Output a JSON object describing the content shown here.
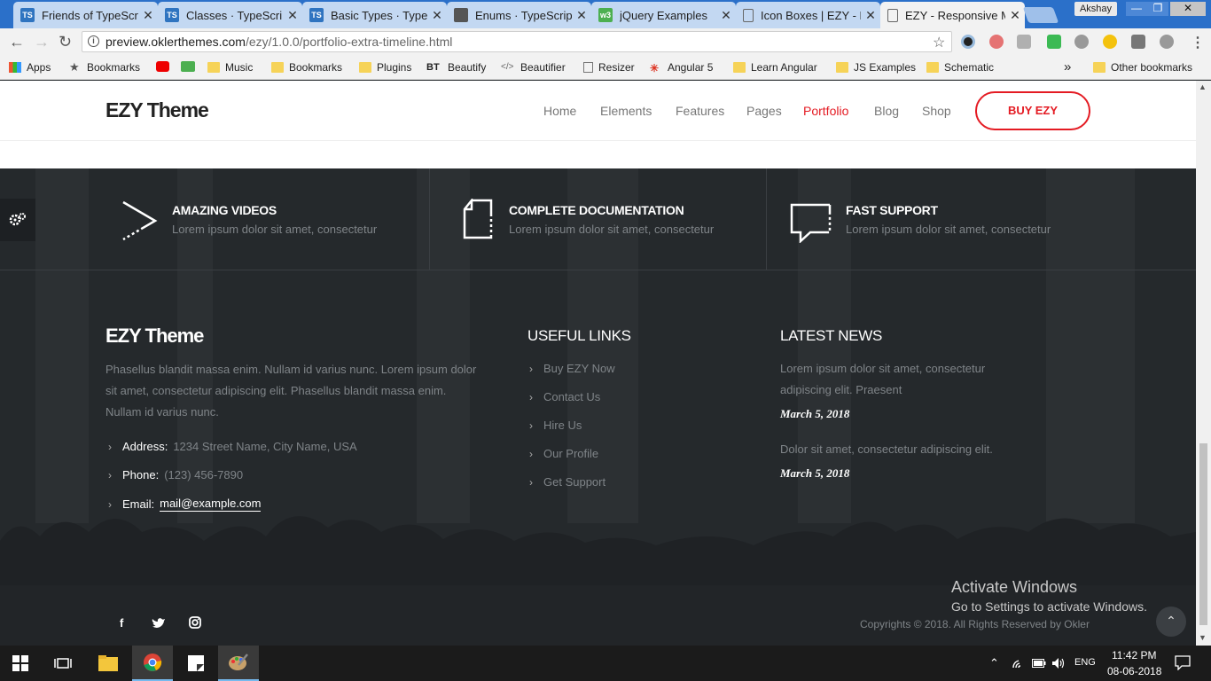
{
  "browser": {
    "tabs": [
      {
        "title": "Friends of TypeScrip",
        "icon": "TS"
      },
      {
        "title": "Classes · TypeScript",
        "icon": "TS"
      },
      {
        "title": "Basic Types · TypeSc",
        "icon": "TS"
      },
      {
        "title": "Enums · TypeScript",
        "icon": "book"
      },
      {
        "title": "jQuery Examples",
        "icon": "w3"
      },
      {
        "title": "Icon Boxes | EZY - R",
        "icon": "page"
      },
      {
        "title": "EZY - Responsive M",
        "icon": "page"
      }
    ],
    "profile": "Akshay",
    "url_host": "preview.oklerthemes.com",
    "url_path": "/ezy/1.0.0/portfolio-extra-timeline.html",
    "bookmarks": [
      "Apps",
      "Bookmarks",
      "Music",
      "Bookmarks",
      "Plugins",
      "Beautify",
      "Beautifier",
      "Resizer",
      "Angular 5",
      "Learn Angular",
      "JS Examples",
      "Schematic"
    ],
    "bookmarks_more": "»",
    "other_bookmarks": "Other bookmarks"
  },
  "site": {
    "logo": "EZY Theme",
    "nav": [
      "Home",
      "Elements",
      "Features",
      "Pages",
      "Portfolio",
      "Blog",
      "Shop"
    ],
    "nav_active": "Portfolio",
    "buy": "BUY EZY",
    "accent": "#e41b23"
  },
  "features": [
    {
      "title": "AMAZING VIDEOS",
      "desc": "Lorem ipsum dolor sit amet, consectetur",
      "icon": "play-icon"
    },
    {
      "title": "COMPLETE DOCUMENTATION",
      "desc": "Lorem ipsum dolor sit amet, consectetur",
      "icon": "document-icon"
    },
    {
      "title": "FAST SUPPORT",
      "desc": "Lorem ipsum dolor sit amet, consectetur",
      "icon": "chat-icon"
    }
  ],
  "footer": {
    "about": {
      "logo": "EZY Theme",
      "text1": "Phasellus blandit massa enim. Nullam id varius nunc. Lorem ipsum dolor",
      "text2": "sit amet, consectetur adipiscing elit. Phasellus blandit massa enim.",
      "text3": "Nullam id varius nunc.",
      "address_label": "Address:",
      "address": "1234 Street Name, City Name, USA",
      "phone_label": "Phone:",
      "phone": "(123) 456-7890",
      "email_label": "Email:",
      "email": "mail@example.com"
    },
    "links": {
      "title": "USEFUL LINKS",
      "items": [
        "Buy EZY Now",
        "Contact Us",
        "Hire Us",
        "Our Profile",
        "Get Support"
      ]
    },
    "news": {
      "title": "LATEST NEWS",
      "items": [
        {
          "line1": "Lorem ipsum dolor sit amet, consectetur",
          "line2": "adipiscing elit. Praesent",
          "date": "March 5, 2018"
        },
        {
          "line1": "Dolor sit amet, consectetur adipiscing elit.",
          "line2": "",
          "date": "March 5, 2018"
        }
      ]
    },
    "copyright": "Copyrights © 2018. All Rights Reserved by Okler",
    "social": [
      "facebook-icon",
      "twitter-icon",
      "instagram-icon"
    ]
  },
  "watermark": {
    "title": "Activate Windows",
    "subtitle": "Go to Settings to activate Windows."
  },
  "taskbar": {
    "lang": "ENG",
    "time": "11:42 PM",
    "date": "08-06-2018"
  }
}
